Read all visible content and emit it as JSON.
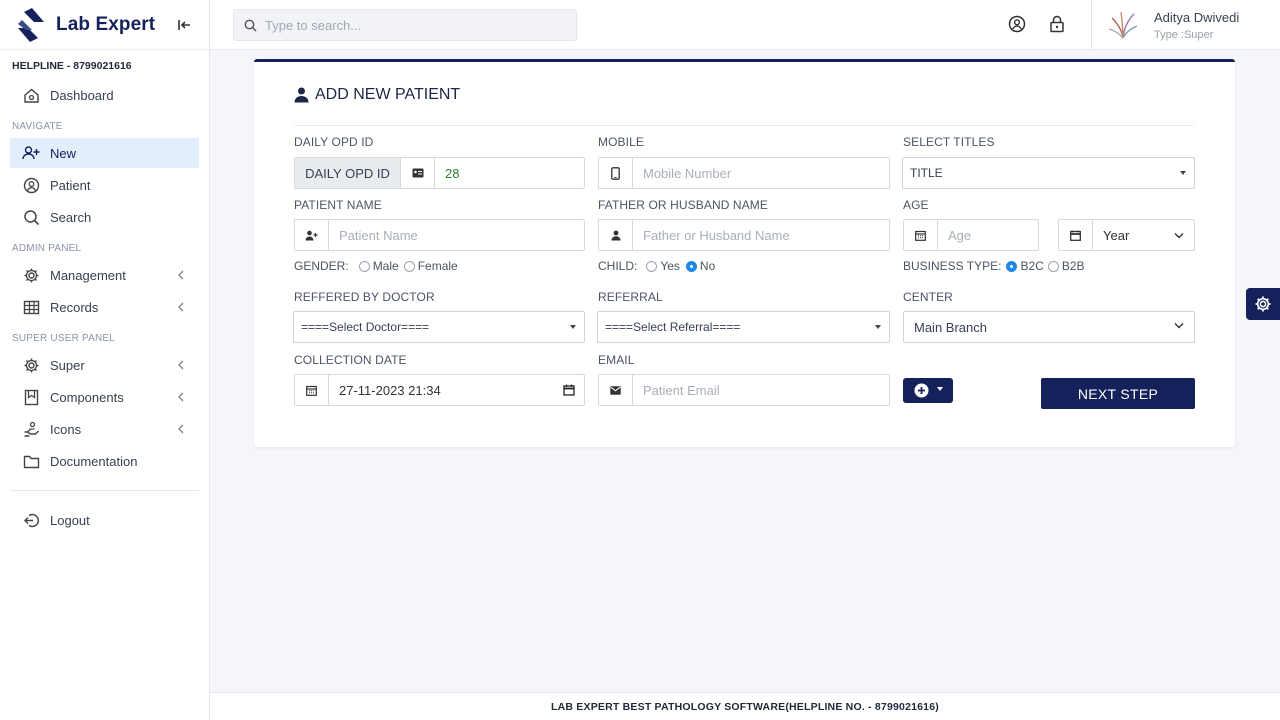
{
  "brand": {
    "name": "Lab Expert"
  },
  "sidebar": {
    "helpline": "HELPLINE - 8799021616",
    "dashboard": "Dashboard",
    "sections": {
      "navigate": "NAVIGATE",
      "admin": "ADMIN PANEL",
      "super": "SUPER USER PANEL"
    },
    "navigate_items": {
      "new": "New",
      "patient": "Patient",
      "search": "Search"
    },
    "admin_items": {
      "management": "Management",
      "records": "Records"
    },
    "super_items": {
      "super": "Super",
      "components": "Components",
      "icons": "Icons",
      "documentation": "Documentation"
    },
    "logout": "Logout",
    "active_item": "New"
  },
  "topbar": {
    "search_placeholder": "Type to search...",
    "user": {
      "name": "Aditya Dwivedi",
      "type": "Type :Super"
    }
  },
  "form": {
    "title": "ADD NEW PATIENT",
    "daily_opd": {
      "label": "DAILY OPD ID",
      "prefix": "DAILY OPD ID",
      "value": "28"
    },
    "mobile": {
      "label": "MOBILE",
      "placeholder": "Mobile Number"
    },
    "titles": {
      "label": "SELECT TITLES",
      "value": "TITLE"
    },
    "patient_name": {
      "label": "PATIENT NAME",
      "placeholder": "Patient Name"
    },
    "guardian_name": {
      "label": "FATHER OR HUSBAND NAME",
      "placeholder": "Father or Husband Name"
    },
    "age": {
      "label": "AGE",
      "placeholder": "Age",
      "unit": "Year"
    },
    "gender": {
      "label": "GENDER:",
      "options": [
        "Male",
        "Female"
      ],
      "selected": null
    },
    "child": {
      "label": "CHILD:",
      "options": [
        "Yes",
        "No"
      ],
      "selected": "No"
    },
    "business_type": {
      "label": "BUSINESS TYPE:",
      "options": [
        "B2C",
        "B2B"
      ],
      "selected": "B2C"
    },
    "doctor": {
      "label": "REFFERED BY DOCTOR",
      "value": "====Select Doctor===="
    },
    "referral": {
      "label": "REFERRAL",
      "value": "====Select Referral===="
    },
    "center": {
      "label": "CENTER",
      "value": "Main Branch"
    },
    "collection_date": {
      "label": "COLLECTION DATE",
      "value": "27-11-2023 21:34"
    },
    "email": {
      "label": "EMAIL",
      "placeholder": "Patient Email"
    },
    "next_label": "NEXT STEP"
  },
  "footer": {
    "text": "LAB EXPERT BEST PATHOLOGY SOFTWARE(HELPLINE NO. - 8799021616)"
  },
  "colors": {
    "primary": "#14215a",
    "active_bg": "#e3eefc",
    "radio_on": "#1e88e5",
    "opd_value": "#2e7d32"
  },
  "icons": [
    "logo-icon",
    "collapse-icon",
    "home-icon",
    "user-plus-icon",
    "user-circle-icon",
    "search-icon",
    "gear-icon",
    "grid-icon",
    "bookmark-icon",
    "hand-icon",
    "folder-icon",
    "logout-icon",
    "lock-icon",
    "calendar-icon",
    "envelope-icon",
    "phone-icon",
    "person-icon",
    "id-card-icon",
    "plus-circle-icon"
  ]
}
